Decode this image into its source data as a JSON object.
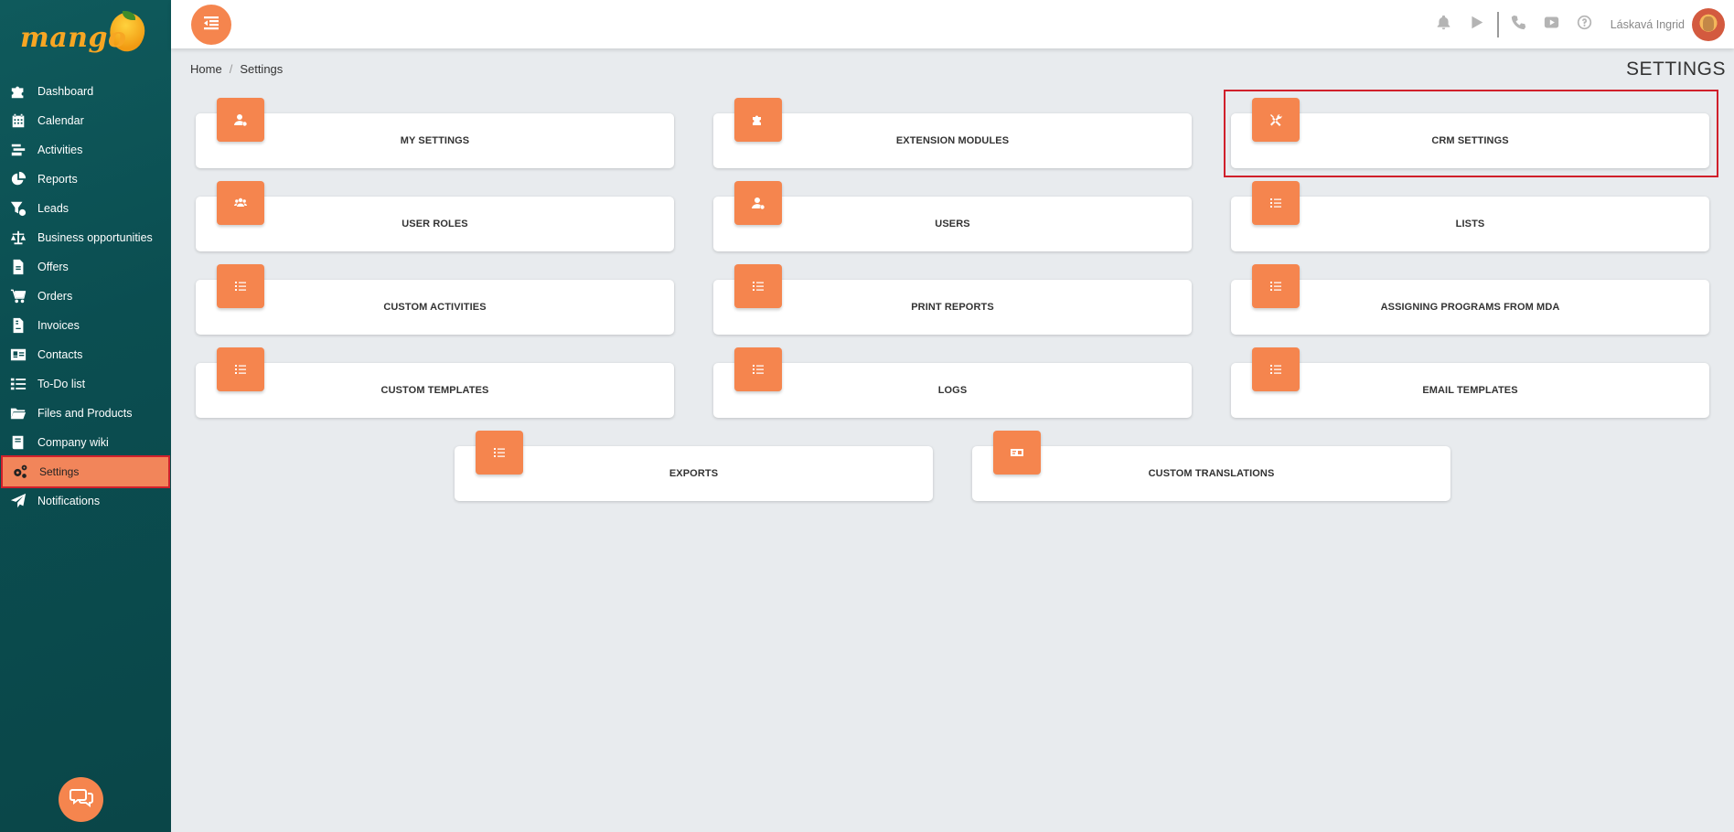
{
  "app": {
    "logo_text": "mango"
  },
  "sidebar": {
    "items": [
      {
        "label": "Dashboard",
        "icon": "puzzle-icon"
      },
      {
        "label": "Calendar",
        "icon": "calendar-icon"
      },
      {
        "label": "Activities",
        "icon": "activities-icon"
      },
      {
        "label": "Reports",
        "icon": "pie-chart-icon"
      },
      {
        "label": "Leads",
        "icon": "funnel-icon"
      },
      {
        "label": "Business opportunities",
        "icon": "scale-icon"
      },
      {
        "label": "Offers",
        "icon": "document-icon"
      },
      {
        "label": "Orders",
        "icon": "cart-icon"
      },
      {
        "label": "Invoices",
        "icon": "invoice-icon"
      },
      {
        "label": "Contacts",
        "icon": "contact-card-icon"
      },
      {
        "label": "To-Do list",
        "icon": "checklist-icon"
      },
      {
        "label": "Files and Products",
        "icon": "folder-icon"
      },
      {
        "label": "Company wiki",
        "icon": "book-icon"
      },
      {
        "label": "Settings",
        "icon": "gears-icon",
        "active": true
      },
      {
        "label": "Notifications",
        "icon": "paper-plane-icon"
      }
    ]
  },
  "topbar": {
    "icons": [
      "bell-icon",
      "play-icon",
      "phone-icon",
      "youtube-icon",
      "help-icon"
    ],
    "username": "Láskavá Ingrid"
  },
  "breadcrumb": {
    "home": "Home",
    "separator": "/",
    "current": "Settings"
  },
  "page": {
    "title": "SETTINGS"
  },
  "cards": [
    {
      "label": "MY SETTINGS",
      "icon": "user-gear-icon"
    },
    {
      "label": "EXTENSION MODULES",
      "icon": "puzzle-icon"
    },
    {
      "label": "CRM SETTINGS",
      "icon": "tools-icon",
      "highlighted": true
    },
    {
      "label": "USER ROLES",
      "icon": "users-icon"
    },
    {
      "label": "USERS",
      "icon": "user-gear-icon"
    },
    {
      "label": "LISTS",
      "icon": "list-icon"
    },
    {
      "label": "CUSTOM ACTIVITIES",
      "icon": "list-icon"
    },
    {
      "label": "PRINT REPORTS",
      "icon": "list-icon"
    },
    {
      "label": "ASSIGNING PROGRAMS FROM MDA",
      "icon": "list-icon"
    },
    {
      "label": "CUSTOM TEMPLATES",
      "icon": "list-icon"
    },
    {
      "label": "LOGS",
      "icon": "list-icon"
    },
    {
      "label": "EMAIL TEMPLATES",
      "icon": "list-icon"
    },
    {
      "label": "EXPORTS",
      "icon": "list-icon"
    },
    {
      "label": "CUSTOM TRANSLATIONS",
      "icon": "translation-card-icon"
    }
  ],
  "colors": {
    "accent": "#f5854e",
    "sidebar": "#0b4e51",
    "highlight": "#d0202b",
    "background": "#e8ebee"
  }
}
